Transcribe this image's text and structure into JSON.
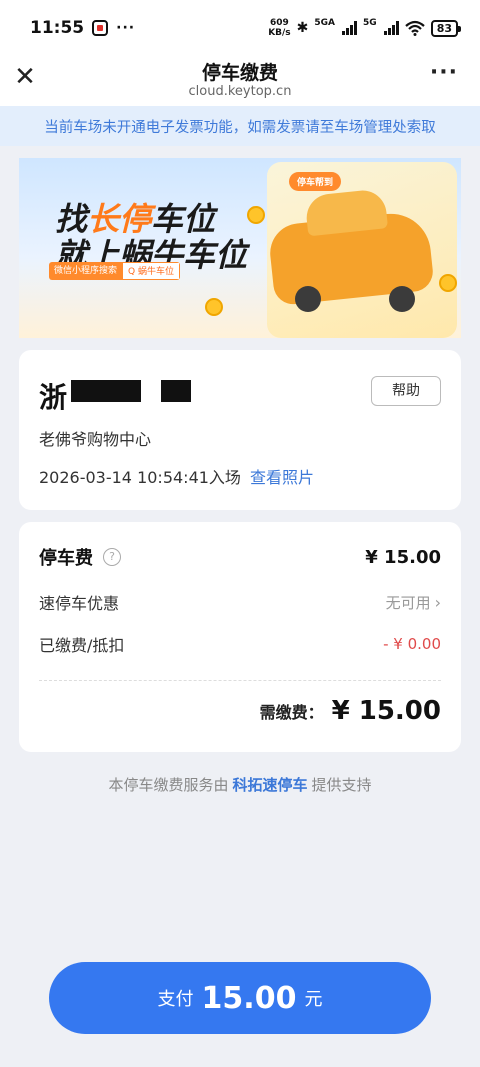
{
  "status_bar": {
    "time": "11:55",
    "speed_value": "609",
    "speed_unit": "KB/s",
    "network1": "5GA",
    "network2": "5G",
    "battery": "83"
  },
  "header": {
    "title": "停车缴费",
    "domain": "cloud.keytop.cn"
  },
  "notice": "当前车场未开通电子发票功能，如需发票请至车场管理处索取",
  "banner": {
    "slogan_prefix": "找",
    "slogan_highlight": "长停",
    "slogan_suffix": "车位",
    "slogan_line2": "就上蜗牛车位",
    "pill_left": "微信小程序搜索",
    "pill_right": "Q 蜗牛车位",
    "badge": "停车帮到"
  },
  "vehicle": {
    "plate_prefix": "浙",
    "help_label": "帮助",
    "lot_name": "老佛爷购物中心",
    "entry_time": "2026-03-14 10:54:41入场",
    "view_photo": "查看照片"
  },
  "fees": {
    "parking_fee_label": "停车费",
    "help_glyph": "?",
    "parking_fee_value": "¥ 15.00",
    "discount_label": "速停车优惠",
    "discount_value": "无可用",
    "paid_label": "已缴费/抵扣",
    "paid_value": "- ¥ 0.00",
    "due_label": "需缴费：",
    "due_value": "¥ 15.00"
  },
  "service": {
    "prefix": "本停车缴费服务由",
    "brand": "科拓速停车",
    "suffix": "提供支持"
  },
  "pay_button": {
    "prefix": "支付",
    "amount": "15.00",
    "suffix": "元"
  },
  "colors": {
    "accent_blue": "#3578f0",
    "link_blue": "#3c78d8",
    "notice_bg": "#e3eefc",
    "deduction_red": "#e04a4a"
  },
  "icons": {
    "close": "close-icon",
    "more": "more-icon",
    "help": "question-circle-icon",
    "chevron": "chevron-right-icon"
  }
}
